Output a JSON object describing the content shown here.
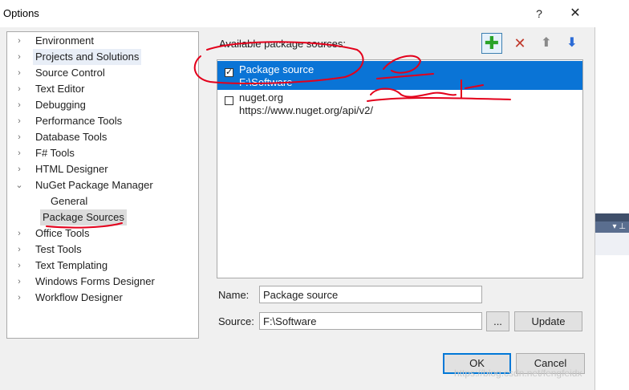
{
  "window": {
    "title": "Options",
    "help_glyph": "?",
    "close_glyph": "✕"
  },
  "tree": {
    "items": [
      {
        "label": "Environment",
        "expander": "›"
      },
      {
        "label": "Projects and Solutions",
        "expander": "›"
      },
      {
        "label": "Source Control",
        "expander": "›"
      },
      {
        "label": "Text Editor",
        "expander": "›"
      },
      {
        "label": "Debugging",
        "expander": "›"
      },
      {
        "label": "Performance Tools",
        "expander": "›"
      },
      {
        "label": "Database Tools",
        "expander": "›"
      },
      {
        "label": "F# Tools",
        "expander": "›"
      },
      {
        "label": "HTML Designer",
        "expander": "›"
      },
      {
        "label": "NuGet Package Manager",
        "expander": "⌄"
      },
      {
        "label": "General",
        "expander": ""
      },
      {
        "label": "Package Sources",
        "expander": ""
      },
      {
        "label": "Office Tools",
        "expander": "›"
      },
      {
        "label": "Test Tools",
        "expander": "›"
      },
      {
        "label": "Text Templating",
        "expander": "›"
      },
      {
        "label": "Windows Forms Designer",
        "expander": "›"
      },
      {
        "label": "Workflow Designer",
        "expander": "›"
      }
    ]
  },
  "sources": {
    "heading": "Available package sources:",
    "toolbar": {
      "add_glyph": "✚",
      "remove_glyph": "✕",
      "up_glyph": "⬆",
      "down_glyph": "⬇"
    },
    "list": [
      {
        "name": "Package source",
        "url": "F:\\Software",
        "checked": true,
        "check_glyph": "✓"
      },
      {
        "name": "nuget.org",
        "url": "https://www.nuget.org/api/v2/",
        "checked": false,
        "check_glyph": ""
      }
    ]
  },
  "form": {
    "name_label": "Name:",
    "name_value": "Package source",
    "source_label": "Source:",
    "source_value": "F:\\Software",
    "browse_label": "...",
    "update_label": "Update"
  },
  "footer": {
    "ok_label": "OK",
    "cancel_label": "Cancel"
  },
  "background": {
    "pin_glyph": "▾ ⊥"
  },
  "watermark": "https://blog.csdn.net/fengfeidx",
  "colors": {
    "selection": "#0a74d6",
    "annotation": "#e3001b",
    "accent": "#0078d7"
  }
}
